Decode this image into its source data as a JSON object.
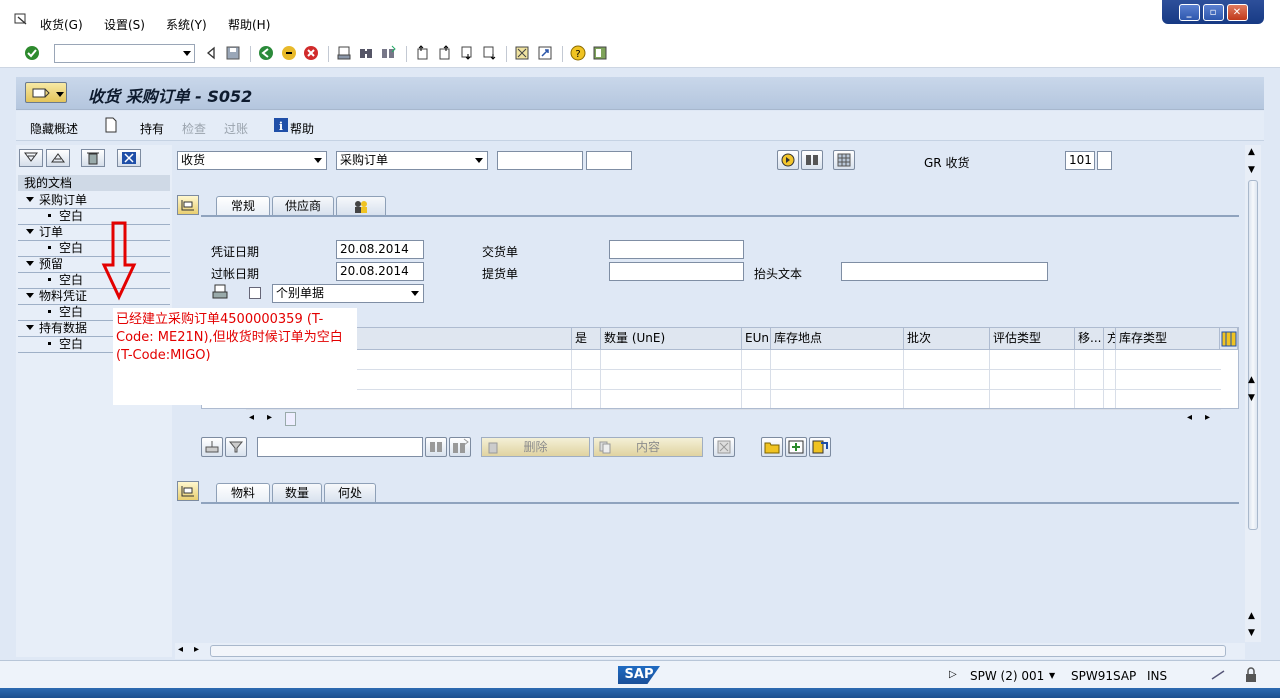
{
  "menu": {
    "items": [
      "收货(G)",
      "设置(S)",
      "系统(Y)",
      "帮助(H)"
    ]
  },
  "window": {
    "title": "收货 采购订单 - S052"
  },
  "apptoolbar": {
    "hide_overview": "隐藏概述",
    "hold": "持有",
    "check": "检查",
    "post": "过账",
    "help": "帮助"
  },
  "tree": {
    "header": "我的文档",
    "nodes": [
      {
        "label": "采购订单",
        "child": "空白"
      },
      {
        "label": "订单",
        "child": "空白"
      },
      {
        "label": "预留",
        "child": "空白"
      },
      {
        "label": "物料凭证",
        "child": "空白"
      },
      {
        "label": "持有数据",
        "child": "空白"
      }
    ]
  },
  "header": {
    "action": "收货",
    "reference": "采购订单",
    "po_number": "",
    "po_item": "",
    "gr_label": "GR 收货",
    "movement_type": "101"
  },
  "tabs_top": [
    "常规",
    "供应商"
  ],
  "general": {
    "doc_date_label": "凭证日期",
    "doc_date": "20.08.2014",
    "post_date_label": "过帐日期",
    "post_date": "20.08.2014",
    "delivery_note_label": "交货单",
    "bill_of_lading_label": "提货单",
    "header_text_label": "抬头文本",
    "slip_type": "个别单据"
  },
  "grid": {
    "columns": [
      "是",
      "数量 (UnE)",
      "EUn",
      "库存地点",
      "批次",
      "评估类型",
      "移...",
      "方",
      "库存类型"
    ]
  },
  "buttons": {
    "delete": "删除",
    "contents": "内容"
  },
  "tabs_bottom": [
    "物料",
    "数量",
    "何处"
  ],
  "status": {
    "logo": "SAP",
    "session": "SPW (2) 001",
    "server": "SPW91SAP",
    "mode": "INS"
  },
  "annotation": {
    "text": "已经建立采购订单4500000359 (T-Code: ME21N),但收货时候订单为空白(T-Code:MIGO)"
  },
  "colors": {
    "annotation": "#e30000",
    "title_bg": "#c9d7ea"
  }
}
